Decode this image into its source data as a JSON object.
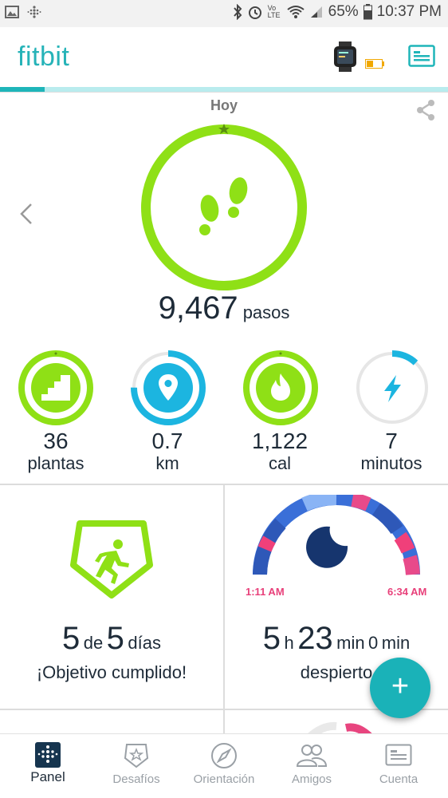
{
  "status_bar": {
    "battery": "65%",
    "time": "10:37 PM",
    "network": "Vo LTE"
  },
  "app": {
    "logo": "fitbit",
    "device_icon": "watch-icon",
    "profile_icon": "profile-card-icon"
  },
  "main": {
    "day_label": "Hoy",
    "steps": {
      "value": "9,467",
      "unit": "pasos"
    },
    "stats": [
      {
        "value": "36",
        "unit": "plantas",
        "icon": "stairs-icon",
        "color": "#8fe016",
        "progress": 1.0
      },
      {
        "value": "0.7",
        "unit": "km",
        "icon": "location-pin-icon",
        "color": "#1cb5e0",
        "progress": 0.75
      },
      {
        "value": "1,122",
        "unit": "cal",
        "icon": "flame-icon",
        "color": "#8fe016",
        "progress": 1.0
      },
      {
        "value": "7",
        "unit": "minutos",
        "icon": "lightning-icon",
        "color": "#1cb5e0",
        "progress": 0.12
      }
    ]
  },
  "tiles": {
    "exercise": {
      "count_a": "5",
      "de": "de",
      "count_b": "5",
      "dias": "días",
      "subtitle": "¡Objetivo cumplido!"
    },
    "sleep": {
      "start_time": "1:11 AM",
      "end_time": "6:34 AM",
      "hours": "5",
      "h": "h",
      "minutes": "23",
      "min": "min",
      "awake": "0",
      "awake_unit": "min",
      "subtitle": "despierto"
    }
  },
  "fab_label": "+",
  "bottom_nav": [
    {
      "label": "Panel",
      "icon": "dashboard-icon",
      "active": true
    },
    {
      "label": "Desafíos",
      "icon": "challenge-badge-icon",
      "active": false
    },
    {
      "label": "Orientación",
      "icon": "compass-icon",
      "active": false
    },
    {
      "label": "Amigos",
      "icon": "friends-icon",
      "active": false
    },
    {
      "label": "Cuenta",
      "icon": "account-card-icon",
      "active": false
    }
  ],
  "colors": {
    "accent": "#1fb5b9",
    "green": "#8fe016",
    "blue": "#1cb5e0",
    "navy": "#1e2b38"
  }
}
